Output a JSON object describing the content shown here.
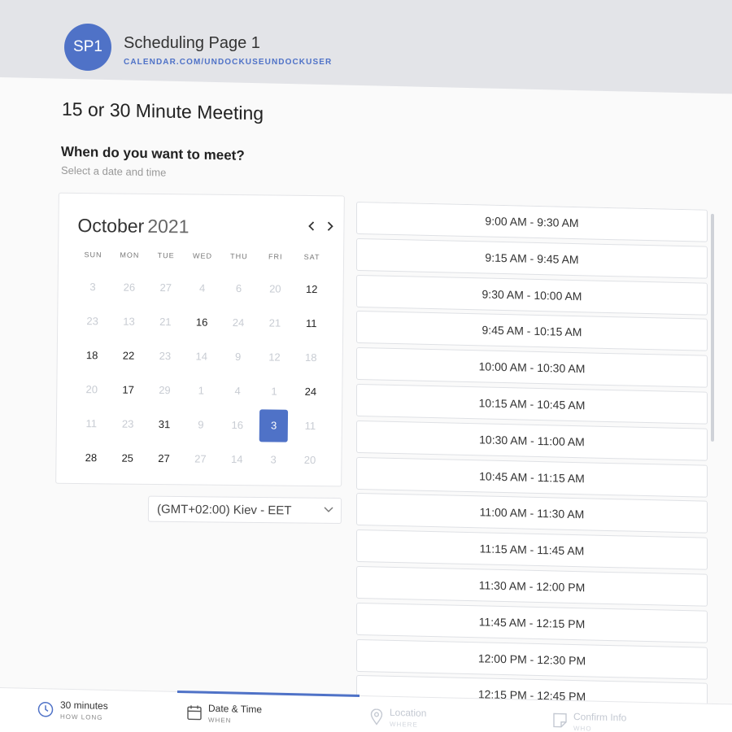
{
  "header": {
    "avatar_initials": "SP1",
    "page_name": "Scheduling Page 1",
    "url": "CALENDAR.COM/UNDOCKUSEUNDOCKUSER"
  },
  "meeting": {
    "title": "15 or 30 Minute Meeting",
    "question": "When do you want to meet?",
    "subtitle": "Select a date and time"
  },
  "calendar": {
    "month": "October",
    "year": "2021",
    "prev_icon": "chevron-left-icon",
    "next_icon": "chevron-right-icon",
    "weekdays": [
      "SUN",
      "MON",
      "TUE",
      "WED",
      "THU",
      "FRI",
      "SAT"
    ],
    "days": [
      {
        "d": "3",
        "active": false
      },
      {
        "d": "26",
        "active": false
      },
      {
        "d": "27",
        "active": false
      },
      {
        "d": "4",
        "active": false
      },
      {
        "d": "6",
        "active": false
      },
      {
        "d": "20",
        "active": false
      },
      {
        "d": "12",
        "active": true
      },
      {
        "d": "23",
        "active": false
      },
      {
        "d": "13",
        "active": false
      },
      {
        "d": "21",
        "active": false
      },
      {
        "d": "16",
        "active": true
      },
      {
        "d": "24",
        "active": false
      },
      {
        "d": "21",
        "active": false
      },
      {
        "d": "11",
        "active": true
      },
      {
        "d": "18",
        "active": true
      },
      {
        "d": "22",
        "active": true
      },
      {
        "d": "23",
        "active": false
      },
      {
        "d": "14",
        "active": false
      },
      {
        "d": "9",
        "active": false
      },
      {
        "d": "12",
        "active": false
      },
      {
        "d": "18",
        "active": false
      },
      {
        "d": "20",
        "active": false
      },
      {
        "d": "17",
        "active": true
      },
      {
        "d": "29",
        "active": false
      },
      {
        "d": "1",
        "active": false
      },
      {
        "d": "4",
        "active": false
      },
      {
        "d": "1",
        "active": false
      },
      {
        "d": "24",
        "active": true
      },
      {
        "d": "11",
        "active": false
      },
      {
        "d": "23",
        "active": false
      },
      {
        "d": "31",
        "active": true
      },
      {
        "d": "9",
        "active": false
      },
      {
        "d": "16",
        "active": false
      },
      {
        "d": "3",
        "active": true,
        "selected": true
      },
      {
        "d": "11",
        "active": false
      },
      {
        "d": "28",
        "active": true
      },
      {
        "d": "25",
        "active": true
      },
      {
        "d": "27",
        "active": true
      },
      {
        "d": "27",
        "active": false
      },
      {
        "d": "14",
        "active": false
      },
      {
        "d": "3",
        "active": false
      },
      {
        "d": "20",
        "active": false
      }
    ]
  },
  "timezone": {
    "value": "(GMT+02:00) Kiev - EET",
    "icon": "chevron-down-icon"
  },
  "slots": [
    "9:00 AM - 9:30 AM",
    "9:15 AM - 9:45 AM",
    "9:30 AM - 10:00 AM",
    "9:45 AM - 10:15 AM",
    "10:00 AM - 10:30 AM",
    "10:15 AM - 10:45 AM",
    "10:30 AM - 11:00 AM",
    "10:45 AM - 11:15 AM",
    "11:00 AM - 11:30 AM",
    "11:15 AM - 11:45 AM",
    "11:30 AM - 12:00 PM",
    "11:45 AM - 12:15 PM",
    "12:00 PM - 12:30 PM",
    "12:15 PM - 12:45 PM"
  ],
  "steps": [
    {
      "title": "30 minutes",
      "sub": "HOW LONG",
      "icon": "clock-icon",
      "enabled": true
    },
    {
      "title": "Date & Time",
      "sub": "WHEN",
      "icon": "calendar-icon",
      "enabled": true
    },
    {
      "title": "Location",
      "sub": "WHERE",
      "icon": "map-pin-icon",
      "enabled": false
    },
    {
      "title": "Confirm Info",
      "sub": "WHO",
      "icon": "note-icon",
      "enabled": false
    }
  ],
  "colors": {
    "accent": "#4f72c7",
    "header_bg": "#e3e4e8",
    "disabled_text": "#c4c9d2"
  }
}
